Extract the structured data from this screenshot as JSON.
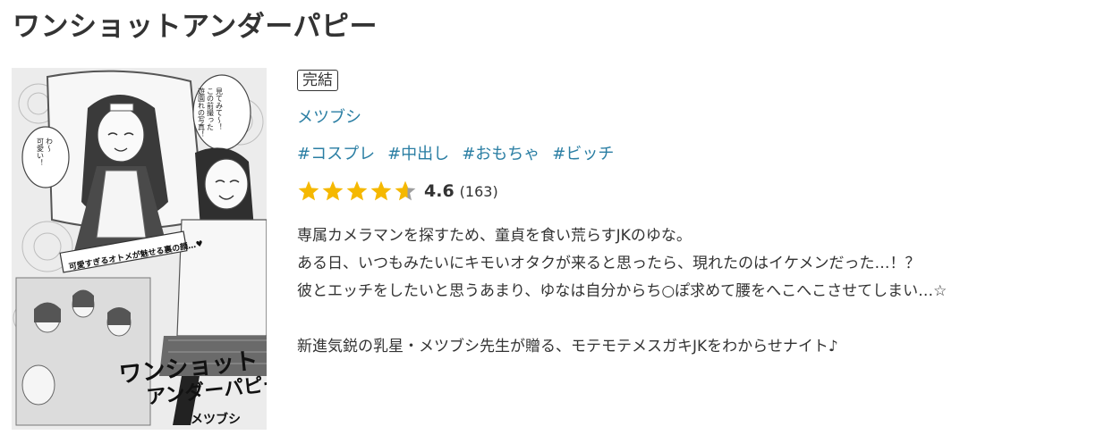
{
  "title": "ワンショットアンダーパピー",
  "cover": {
    "alt": "cover-image",
    "speech_1": "見てみて〜！この前撮った遊園れの写真！",
    "speech_2": "わ〜可愛い！",
    "caption": "可愛すぎるオトメが魅せる裏の顔…♥",
    "logo_line_1": "ワンショット",
    "logo_line_2": "アンダーパピー",
    "author_mark": "メツブシ"
  },
  "status": "完結",
  "author": "メツブシ",
  "tags": [
    "#コスプレ",
    "#中出し",
    "#おもちゃ",
    "#ビッチ"
  ],
  "rating": {
    "value": "4.6",
    "count": "(163)",
    "score": 4.6,
    "max": 5,
    "star_color": "#f5b800",
    "empty_color": "#9e9e9e"
  },
  "description": {
    "lines": [
      "専属カメラマンを探すため、童貞を食い荒らすJKのゆな。",
      "ある日、いつもみたいにキモいオタクが来ると思ったら、現れたのはイケメンだった…！？",
      "彼とエッチをしたいと思うあまり、ゆなは自分からち○ぽ求めて腰をへこへこさせてしまい…☆"
    ],
    "tagline": "新進気鋭の乳星・メツブシ先生が贈る、モテモテメスガキJKをわからせナイト♪"
  },
  "colors": {
    "link": "#2a7ea3",
    "text": "#333333"
  }
}
